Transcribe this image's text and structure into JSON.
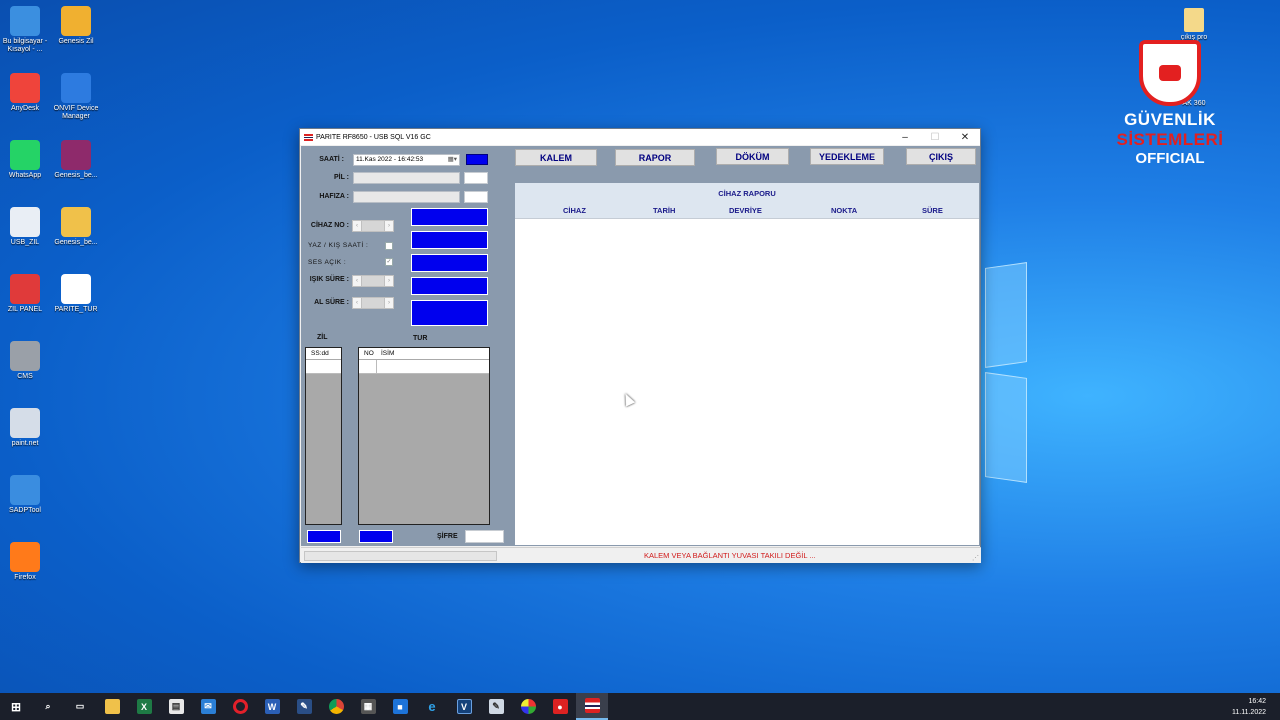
{
  "desktop": {
    "icons": [
      {
        "label": "Bu bilgisayar - Kısayol - ...",
        "icon": "computer-icon",
        "color": "#3b8fe0"
      },
      {
        "label": "Genesis Zil",
        "icon": "folder-icon",
        "color": "#f0b030"
      },
      {
        "label": "AnyDesk",
        "icon": "anydesk-icon",
        "color": "#ef443b"
      },
      {
        "label": "ONVIF Device Manager",
        "icon": "onvif-icon",
        "color": "#2d7be0"
      },
      {
        "label": "WhatsApp",
        "icon": "whatsapp-icon",
        "color": "#25d366"
      },
      {
        "label": "Genesis_be...",
        "icon": "winrar-icon",
        "color": "#8e2a6b"
      },
      {
        "label": "USB_ZIL",
        "icon": "document-icon",
        "color": "#e9eef5"
      },
      {
        "label": "Genesis_be...",
        "icon": "folder-icon",
        "color": "#f0c14a"
      },
      {
        "label": "ZIL PANEL",
        "icon": "bell-icon",
        "color": "#e03a3a"
      },
      {
        "label": "PARITE_TUR",
        "icon": "parite-icon",
        "color": "#ffffff"
      },
      {
        "label": "CMS",
        "icon": "cms-icon",
        "color": "#9aa0a8"
      },
      {
        "label": "paint.net",
        "icon": "paintnet-icon",
        "color": "#d5dde8"
      },
      {
        "label": "SADPTool",
        "icon": "sadp-icon",
        "color": "#3a8de0"
      },
      {
        "label": "Firefox",
        "icon": "firefox-icon",
        "color": "#ff7a1a"
      }
    ],
    "top_right_labels": [
      "çıkış pro",
      "AK 360"
    ],
    "watermark": {
      "line1a": "GÜVENLİK ",
      "line1b": "SİSTEMLERİ",
      "line2": "OFFICIAL"
    }
  },
  "window": {
    "title": "PARITE RF8650 - USB SQL V16 GC",
    "minimize": "–",
    "maximize": "☐",
    "close": "✕"
  },
  "left": {
    "saati_label": "SAATİ :",
    "saati_value": "11.Kas 2022 - 16:42:53",
    "pil_label": "PİL :",
    "hafiza_label": "HAFIZA :",
    "cihaz_no_label": "CİHAZ NO :",
    "yaz_kis_label": "YAZ / KIŞ SAATİ :",
    "ses_label": "SES AÇIK :",
    "ses_checked": "✓",
    "isik_label": "IŞIK SÜRE :",
    "al_sure_label": "AL SÜRE :",
    "zil_label": "ZİL",
    "tur_label": "TUR",
    "zil_col": "SS:dd",
    "tur_col_no": "NO",
    "tur_col_isim": "İSİM",
    "sifre_label": "ŞİFRE"
  },
  "toolbar": {
    "kalem": "KALEM",
    "rapor": "RAPOR",
    "dokum": "DÖKÜM",
    "yedekleme": "YEDEKLEME",
    "cikis": "ÇIKIŞ"
  },
  "report": {
    "title": "CİHAZ RAPORU",
    "columns": [
      "CİHAZ",
      "TARİH",
      "DEVRİYE",
      "NOKTA",
      "SÜRE"
    ]
  },
  "status": {
    "message": "KALEM VEYA BAĞLANTI YUVASI TAKILI DEĞİL ..."
  },
  "taskbar": {
    "time": "16:42",
    "date": "11.11.2022"
  }
}
